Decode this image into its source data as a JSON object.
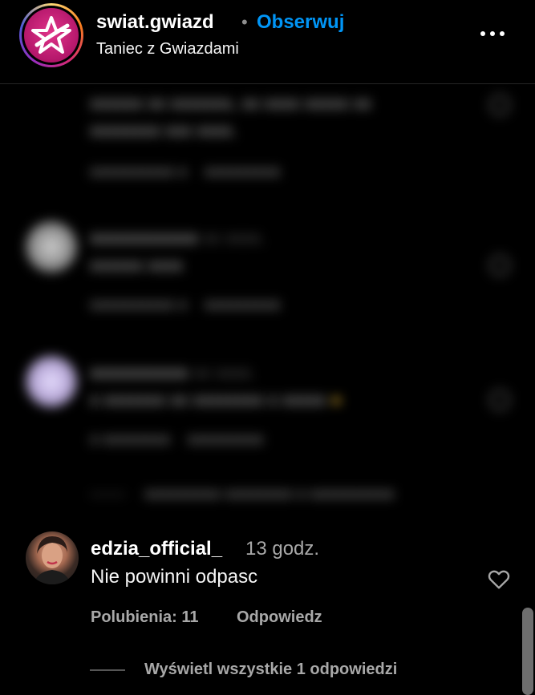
{
  "header": {
    "username": "swiat.gwiazd",
    "separator": "•",
    "follow_label": "Obserwuj",
    "subtitle": "Taniec z Gwiazdami",
    "avatar_icon": "pink-star-logo",
    "more_icon": "more-horizontal-icon"
  },
  "comment": {
    "username": "edzia_official_",
    "time": "13 godz.",
    "text": "Nie powinni odpasc",
    "likes_label": "Polubienia: 11",
    "reply_label": "Odpowiedz",
    "like_icon": "heart-outline-icon",
    "view_replies_label": "Wyświetl wszystkie 1 odpowiedzi"
  },
  "colors": {
    "background": "#000000",
    "link_blue": "#0095f6",
    "text_primary": "#f5f5f5",
    "text_secondary": "#a8a8a8",
    "brand_pink": "#d62976"
  }
}
